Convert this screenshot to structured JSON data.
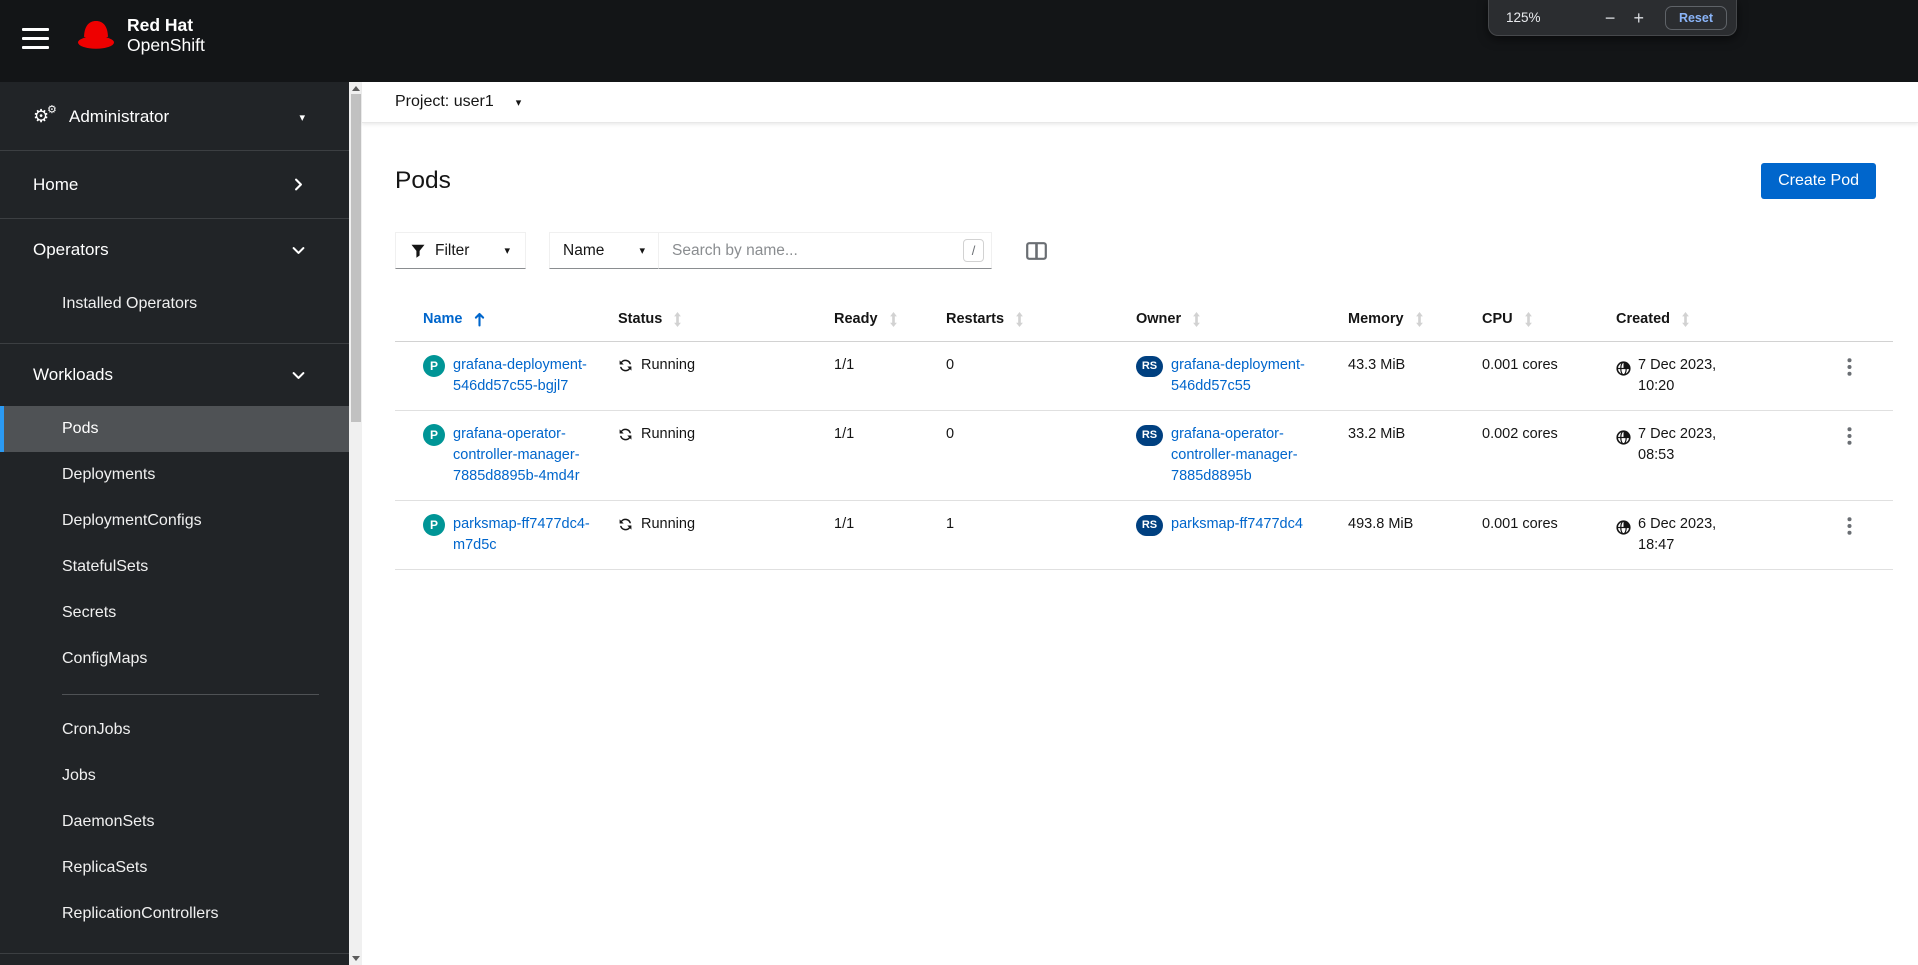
{
  "masthead": {
    "brand": {
      "line1": "Red Hat",
      "line2": "OpenShift"
    },
    "user": {
      "name": "user1"
    }
  },
  "browser_zoom_popup": {
    "level": "125%",
    "minus_label": "−",
    "plus_label": "+",
    "reset_label": "Reset"
  },
  "sidebar": {
    "perspective": {
      "label": "Administrator"
    },
    "sections": [
      {
        "label": "Home",
        "state": "collapsed",
        "items": []
      },
      {
        "label": "Operators",
        "state": "expanded",
        "items": [
          {
            "label": "Installed Operators"
          }
        ]
      },
      {
        "label": "Workloads",
        "state": "expanded",
        "items": [
          {
            "label": "Pods",
            "active": true
          },
          {
            "label": "Deployments"
          },
          {
            "label": "DeploymentConfigs"
          },
          {
            "label": "StatefulSets"
          },
          {
            "label": "Secrets"
          },
          {
            "label": "ConfigMaps",
            "divider_after": true
          },
          {
            "label": "CronJobs"
          },
          {
            "label": "Jobs"
          },
          {
            "label": "DaemonSets"
          },
          {
            "label": "ReplicaSets"
          },
          {
            "label": "ReplicationControllers"
          }
        ]
      }
    ]
  },
  "project_bar": {
    "label": "Project: user1"
  },
  "page": {
    "title": "Pods",
    "create_button_label": "Create Pod"
  },
  "toolbar": {
    "filter_label": "Filter",
    "attribute_label": "Name",
    "search_placeholder": "Search by name...",
    "search_shortcut_hint": "/"
  },
  "table": {
    "columns": [
      {
        "label": "Name",
        "sorted": "asc"
      },
      {
        "label": "Status"
      },
      {
        "label": "Ready"
      },
      {
        "label": "Restarts"
      },
      {
        "label": "Owner"
      },
      {
        "label": "Memory"
      },
      {
        "label": "CPU"
      },
      {
        "label": "Created"
      }
    ],
    "rows": [
      {
        "badge": "P",
        "name": "grafana-deployment-546dd57c55-bgjl7",
        "status": "Running",
        "ready": "1/1",
        "restarts": "0",
        "owner_badge": "RS",
        "owner": "grafana-deployment-546dd57c55",
        "memory": "43.3 MiB",
        "cpu": "0.001 cores",
        "created": "7 Dec 2023, 10:20"
      },
      {
        "badge": "P",
        "name": "grafana-operator-controller-manager-7885d8895b-4md4r",
        "status": "Running",
        "ready": "1/1",
        "restarts": "0",
        "owner_badge": "RS",
        "owner": "grafana-operator-controller-manager-7885d8895b",
        "memory": "33.2 MiB",
        "cpu": "0.002 cores",
        "created": "7 Dec 2023, 08:53"
      },
      {
        "badge": "P",
        "name": "parksmap-ff7477dc4-m7d5c",
        "status": "Running",
        "ready": "1/1",
        "restarts": "1",
        "owner_badge": "RS",
        "owner": "parksmap-ff7477dc4",
        "memory": "493.8 MiB",
        "cpu": "0.001 cores",
        "created": "6 Dec 2023, 18:47"
      }
    ]
  },
  "colors": {
    "brand_red": "#ee0000",
    "primary_blue": "#0066cc",
    "link_blue": "#0066cc",
    "pod_badge": "#009596",
    "replicaset_badge": "#004080",
    "nav_active_bg": "#4f5255",
    "nav_active_border": "#2b9af3"
  }
}
